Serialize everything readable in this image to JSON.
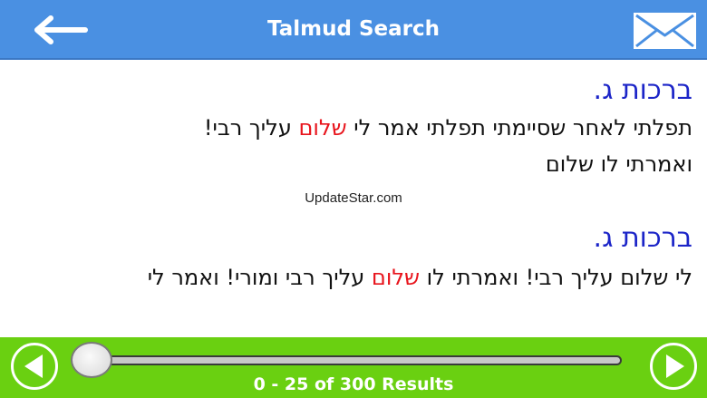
{
  "header": {
    "title": "Talmud Search",
    "back_icon": "back-arrow-icon",
    "mail_icon": "mail-envelope-icon",
    "background": "#4a90e2"
  },
  "results": [
    {
      "ref": "ברכות ג.",
      "lines": [
        {
          "before": "תפלתי לאחר שסיימתי תפלתי אמר לי ",
          "match": "שלום",
          "after": " עליך רבי!"
        },
        {
          "before": "ואמרתי לו שלום",
          "match": "",
          "after": ""
        }
      ]
    },
    {
      "ref": "ברכות ג.",
      "lines": [
        {
          "before": "לי שלום עליך רבי! ואמרתי לו ",
          "match": "שלום",
          "after": " עליך רבי ומורי! ואמר לי"
        }
      ]
    }
  ],
  "watermark": "UpdateStar.com",
  "footer": {
    "results_label": "0 - 25 of 300 Results",
    "slider_position": 0,
    "prev_icon": "prev-arrow-icon",
    "next_icon": "next-arrow-icon",
    "background": "#6ad011"
  },
  "colors": {
    "reference": "#1c25c8",
    "highlight": "#e8141c",
    "text": "#111111"
  }
}
